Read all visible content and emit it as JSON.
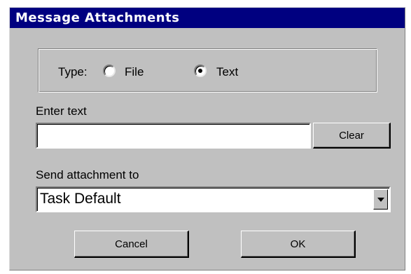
{
  "dialog": {
    "title": "Message Attachments",
    "type_label": "Type:",
    "type_options": [
      {
        "label": "File",
        "checked": false
      },
      {
        "label": "Text",
        "checked": true
      }
    ],
    "enter_text_label": "Enter text",
    "text_value": "",
    "clear_label": "Clear",
    "send_to_label": "Send attachment to",
    "send_to_value": "Task Default",
    "cancel_label": "Cancel",
    "ok_label": "OK"
  },
  "colors": {
    "titlebar": "#000080",
    "face": "#c0c0c0"
  }
}
